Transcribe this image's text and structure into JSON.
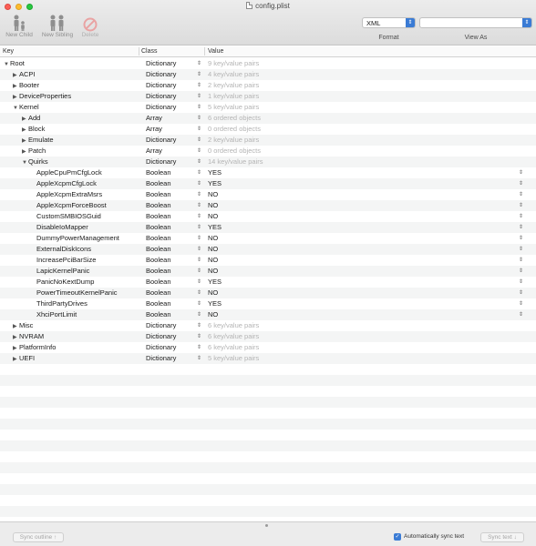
{
  "window": {
    "title": "config.plist"
  },
  "toolbar": {
    "new_child": "New Child",
    "new_sibling": "New Sibling",
    "delete": "Delete",
    "format_value": "XML",
    "format_label": "Format",
    "view_as_value": "",
    "view_as_label": "View As"
  },
  "columns": {
    "key": "Key",
    "class": "Class",
    "value": "Value"
  },
  "rows": [
    {
      "key": "Root",
      "class": "Dictionary",
      "value": "9 key/value pairs",
      "level": 0,
      "disclosure": "open",
      "hint": true
    },
    {
      "key": "ACPI",
      "class": "Dictionary",
      "value": "4 key/value pairs",
      "level": 1,
      "disclosure": "closed",
      "hint": true
    },
    {
      "key": "Booter",
      "class": "Dictionary",
      "value": "2 key/value pairs",
      "level": 1,
      "disclosure": "closed",
      "hint": true
    },
    {
      "key": "DeviceProperties",
      "class": "Dictionary",
      "value": "1 key/value pairs",
      "level": 1,
      "disclosure": "closed",
      "hint": true
    },
    {
      "key": "Kernel",
      "class": "Dictionary",
      "value": "5 key/value pairs",
      "level": 1,
      "disclosure": "open",
      "hint": true
    },
    {
      "key": "Add",
      "class": "Array",
      "value": "6 ordered objects",
      "level": 2,
      "disclosure": "closed",
      "hint": true
    },
    {
      "key": "Block",
      "class": "Array",
      "value": "0 ordered objects",
      "level": 2,
      "disclosure": "closed",
      "hint": true
    },
    {
      "key": "Emulate",
      "class": "Dictionary",
      "value": "2 key/value pairs",
      "level": 2,
      "disclosure": "closed",
      "hint": true
    },
    {
      "key": "Patch",
      "class": "Array",
      "value": "0 ordered objects",
      "level": 2,
      "disclosure": "closed",
      "hint": true
    },
    {
      "key": "Quirks",
      "class": "Dictionary",
      "value": "14 key/value pairs",
      "level": 2,
      "disclosure": "open",
      "hint": true
    },
    {
      "key": "AppleCpuPmCfgLock",
      "class": "Boolean",
      "value": "YES",
      "level": 3,
      "disclosure": "none",
      "hint": false
    },
    {
      "key": "AppleXcpmCfgLock",
      "class": "Boolean",
      "value": "YES",
      "level": 3,
      "disclosure": "none",
      "hint": false
    },
    {
      "key": "AppleXcpmExtraMsrs",
      "class": "Boolean",
      "value": "NO",
      "level": 3,
      "disclosure": "none",
      "hint": false
    },
    {
      "key": "AppleXcpmForceBoost",
      "class": "Boolean",
      "value": "NO",
      "level": 3,
      "disclosure": "none",
      "hint": false
    },
    {
      "key": "CustomSMBIOSGuid",
      "class": "Boolean",
      "value": "NO",
      "level": 3,
      "disclosure": "none",
      "hint": false
    },
    {
      "key": "DisableIoMapper",
      "class": "Boolean",
      "value": "YES",
      "level": 3,
      "disclosure": "none",
      "hint": false
    },
    {
      "key": "DummyPowerManagement",
      "class": "Boolean",
      "value": "NO",
      "level": 3,
      "disclosure": "none",
      "hint": false
    },
    {
      "key": "ExternalDiskIcons",
      "class": "Boolean",
      "value": "NO",
      "level": 3,
      "disclosure": "none",
      "hint": false
    },
    {
      "key": "IncreasePciBarSize",
      "class": "Boolean",
      "value": "NO",
      "level": 3,
      "disclosure": "none",
      "hint": false
    },
    {
      "key": "LapicKernelPanic",
      "class": "Boolean",
      "value": "NO",
      "level": 3,
      "disclosure": "none",
      "hint": false
    },
    {
      "key": "PanicNoKextDump",
      "class": "Boolean",
      "value": "YES",
      "level": 3,
      "disclosure": "none",
      "hint": false
    },
    {
      "key": "PowerTimeoutKernelPanic",
      "class": "Boolean",
      "value": "NO",
      "level": 3,
      "disclosure": "none",
      "hint": false
    },
    {
      "key": "ThirdPartyDrives",
      "class": "Boolean",
      "value": "YES",
      "level": 3,
      "disclosure": "none",
      "hint": false
    },
    {
      "key": "XhciPortLimit",
      "class": "Boolean",
      "value": "NO",
      "level": 3,
      "disclosure": "none",
      "hint": false
    },
    {
      "key": "Misc",
      "class": "Dictionary",
      "value": "6 key/value pairs",
      "level": 1,
      "disclosure": "closed",
      "hint": true
    },
    {
      "key": "NVRAM",
      "class": "Dictionary",
      "value": "6 key/value pairs",
      "level": 1,
      "disclosure": "closed",
      "hint": true
    },
    {
      "key": "PlatformInfo",
      "class": "Dictionary",
      "value": "6 key/value pairs",
      "level": 1,
      "disclosure": "closed",
      "hint": true
    },
    {
      "key": "UEFI",
      "class": "Dictionary",
      "value": "5 key/value pairs",
      "level": 1,
      "disclosure": "closed",
      "hint": true
    }
  ],
  "bottom": {
    "sync_outline": "Sync outline ↑",
    "auto_sync_label": "Automatically sync text",
    "auto_sync_checked": true,
    "sync_text": "Sync text ↓"
  }
}
